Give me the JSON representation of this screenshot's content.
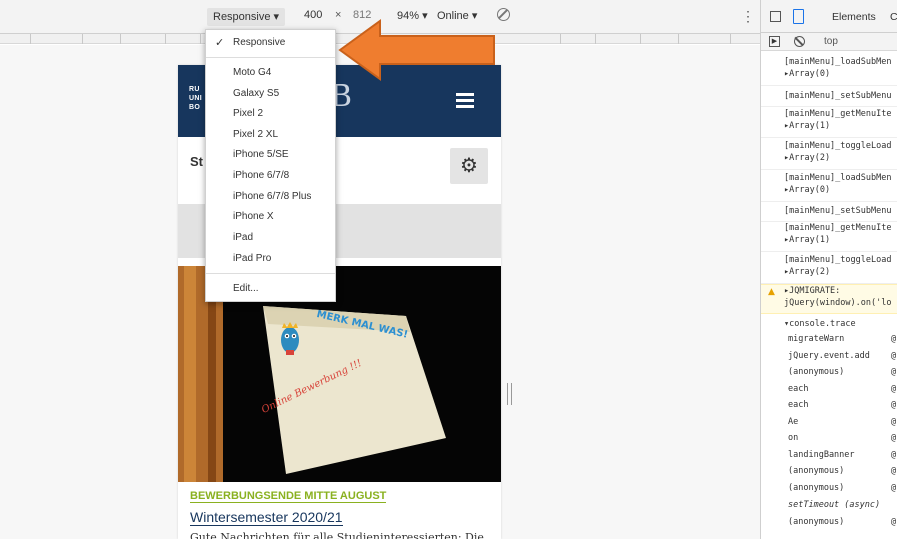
{
  "toolbar": {
    "device": "Responsive ▾",
    "width": "400",
    "times": "×",
    "height": "812",
    "zoom": "94% ▾",
    "network": "Online ▾",
    "kebab": "⋮"
  },
  "device_menu": {
    "check": "✓",
    "items": [
      "Responsive",
      "Moto G4",
      "Galaxy S5",
      "Pixel 2",
      "Pixel 2 XL",
      "iPhone 5/SE",
      "iPhone 6/7/8",
      "iPhone 6/7/8 Plus",
      "iPhone X",
      "iPad",
      "iPad Pro",
      "Edit..."
    ]
  },
  "page": {
    "logo_lines": [
      "RU",
      "UNI",
      "BO"
    ],
    "logo_mark": "B",
    "search_label": "St",
    "settings_glyph": "⚙",
    "news_kicker": "BEWERBUNGSENDE MITTE AUGUST",
    "news_title": "Wintersemester 2020/21",
    "news_teaser": "Gute Nachrichten für alle Studieninteressierten: Die",
    "note_header": "MERK MAL WAS!",
    "note_text": "Online Bewerbung !!!"
  },
  "devtools": {
    "tabs": [
      "Elements",
      "C"
    ],
    "context": "top",
    "logs": [
      {
        "line1": "[mainMenu]_loadSubMen",
        "line2": "▸Array(0)"
      },
      {
        "line1": "[mainMenu]_setSubMenu",
        "line2": ""
      },
      {
        "line1": "[mainMenu]_getMenuIte",
        "line2": "▸Array(1)"
      },
      {
        "line1": "[mainMenu]_toggleLoad",
        "line2": "▸Array(2)"
      },
      {
        "line1": "[mainMenu]_loadSubMen",
        "line2": "▸Array(0)"
      },
      {
        "line1": "[mainMenu]_setSubMenu",
        "line2": ""
      },
      {
        "line1": "[mainMenu]_getMenuIte",
        "line2": "▸Array(1)"
      },
      {
        "line1": "[mainMenu]_toggleLoad",
        "line2": "▸Array(2)"
      }
    ],
    "warning": {
      "icon": "▲",
      "line1": "▸JQMIGRATE:",
      "line2": "jQuery(window).on('lo"
    },
    "trace_header": "▾console.trace",
    "trace": [
      "migrateWarn",
      "jQuery.event.add",
      "(anonymous)",
      "each",
      "each",
      "Ae",
      "on",
      "landingBanner",
      "(anonymous)",
      "(anonymous)",
      "setTimeout (async)",
      "(anonymous)"
    ],
    "trace_at": "@"
  },
  "colors": {
    "header_blue": "#17365d",
    "kicker_green": "#8ab120",
    "arrow_orange": "#ef7d2f",
    "warning_yellow": "#fffbe5"
  }
}
